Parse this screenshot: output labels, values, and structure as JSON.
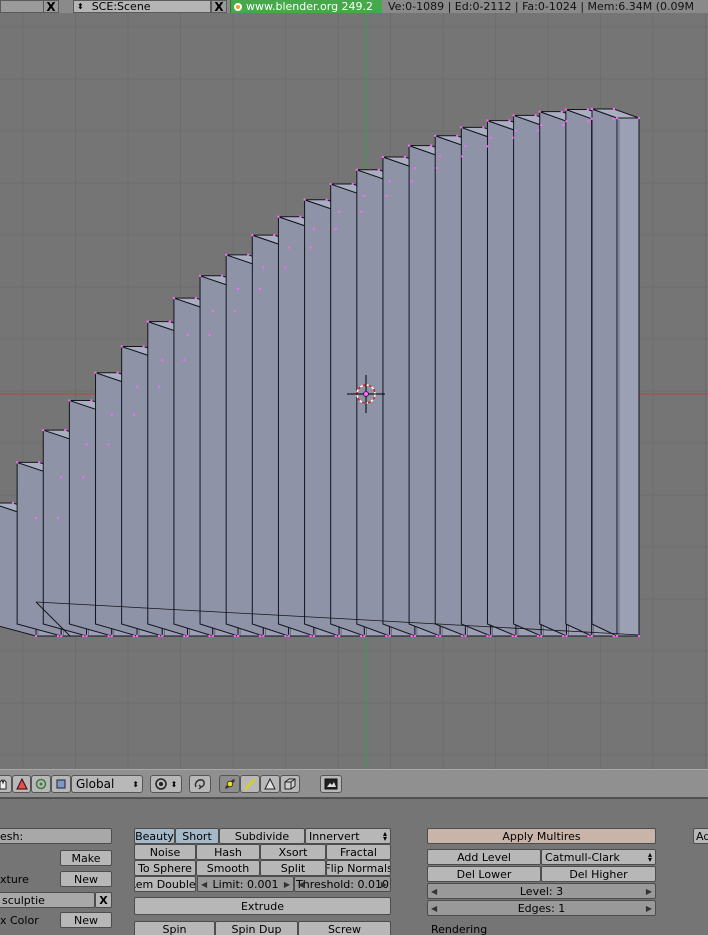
{
  "topbar": {
    "close_label": "X",
    "scene_label": "SCE:Scene",
    "close_label_2": "X",
    "url_label": "www.blender.org 249.2",
    "stats": "Ve:0-1089 | Ed:0-2112 | Fa:0-1024 | Mem:6.34M (0.09M"
  },
  "header3d": {
    "orientation_label": "Global",
    "orientation_arrow": "⬍"
  },
  "panels": {
    "link": {
      "mesh_label": "esh:",
      "make_label": "Make",
      "texture_label": "xture",
      "new_label": "New",
      "sculpt_value": "sculptie",
      "clear_label": "X",
      "color_label": "x Color",
      "new_label_2": "New"
    },
    "mesh_tools": {
      "beauty": "Beauty",
      "short": "Short",
      "subdivide": "Subdivide",
      "innervert": "Innervert",
      "noise": "Noise",
      "hash": "Hash",
      "xsort": "Xsort",
      "fractal": "Fractal",
      "to_sphere": "To Sphere",
      "smooth": "Smooth",
      "split": "Split",
      "flip_normals": "Flip Normals",
      "rem_doubles": "Rem Doubles",
      "limit": "Limit: 0.001",
      "threshold": "Threshold: 0.010",
      "extrude": "Extrude",
      "spin": "Spin",
      "spin_dup": "Spin Dup",
      "screw": "Screw"
    },
    "multires": {
      "apply": "Apply Multires",
      "add_level": "Add Level",
      "subdiv_type": "Catmull-Clark",
      "del_lower": "Del Lower",
      "del_higher": "Del Higher",
      "level": "Level: 3",
      "edges": "Edges: 1",
      "rendering": "Rendering"
    },
    "extra": {
      "ad_label": "Ad"
    }
  },
  "colors": {
    "viewport_bg": "#757575",
    "grid": "#6d6d6d",
    "axis_x": "#b04848",
    "axis_y": "#3fa03f",
    "mesh_fill": "#9ba0b4",
    "mesh_edge": "#14141c",
    "vertex": "#ff66ff",
    "active_toggle": "#a6b9c8"
  },
  "mesh": {
    "slab_count": 24
  }
}
